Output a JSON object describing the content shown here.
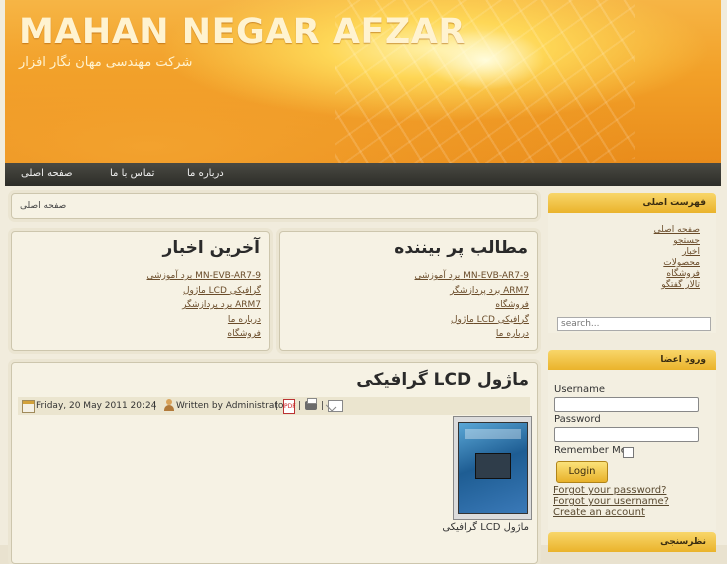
{
  "header": {
    "title": "MAHAN NEGAR AFZAR",
    "subtitle": "شرکت مهندسی مهان نگار افزار"
  },
  "nav": {
    "items": [
      "درباره ما",
      "تماس با ما",
      "صفحه اصلی"
    ]
  },
  "breadcrumb": "صفحه اصلی",
  "popular": {
    "title": "مطالب پر بیننده",
    "items": [
      "برد آموزشی MN-EVB-AR7-9",
      "برد پردازشگر ARM7",
      "فروشگاه",
      "ماژول LCD گرافیکی",
      "درباره ما"
    ]
  },
  "latest": {
    "title": "آخرین اخبار",
    "items": [
      "برد آموزشی MN-EVB-AR7-9",
      "ماژول LCD گرافیکی",
      "برد پردازشگر ARM7",
      "درباره ما",
      "فروشگاه"
    ]
  },
  "article": {
    "title": "ماژول LCD گرافیکی",
    "date": "Friday, 20 May 2011 20:24",
    "author": "Written by Administrator",
    "pdf_icon": "pdf-icon",
    "print_icon": "print-icon",
    "email_icon": "email-icon",
    "caption": "ماژول LCD گرافیکی"
  },
  "sidebar": {
    "menu_title": "فهرست اصلی",
    "menu_items": [
      "صفحه اصلی",
      "جستجو",
      "اخبار",
      "محصولات",
      "فروشگاه",
      "تالار گفتگو"
    ],
    "search_placeholder": "search...",
    "login_title": "ورود اعضا",
    "username_label": "Username",
    "password_label": "Password",
    "remember_label": "Remember Me",
    "login_button": "Login",
    "forgot_password": "Forgot your password?",
    "forgot_username": "Forgot your username?",
    "create_account": "Create an account",
    "poll_title": "نظرسنجی"
  },
  "colors": {
    "accent": "#eab32b",
    "nav_bg": "#2d2d28",
    "link": "#6a4c2a"
  }
}
